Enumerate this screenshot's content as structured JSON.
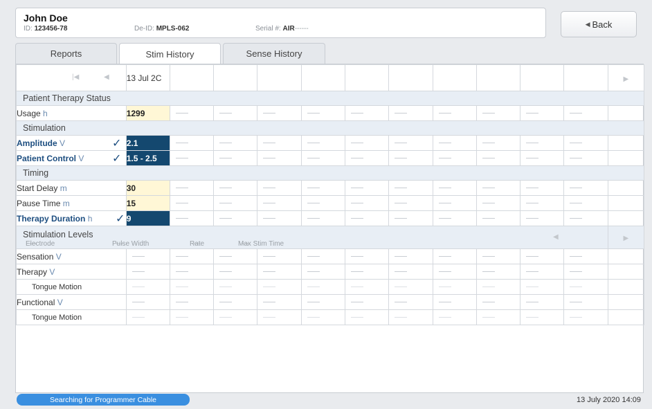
{
  "patient": {
    "name": "John Doe",
    "id_label": "ID:",
    "id_value": "123456-78",
    "deid_label": "De-ID:",
    "deid_value": "MPLS-062",
    "serial_label": "Serial #:",
    "serial_value": "AIR",
    "serial_suffix": "------"
  },
  "back_button": {
    "label": "Back"
  },
  "tabs": [
    {
      "label": "Reports",
      "active": false
    },
    {
      "label": "Stim History",
      "active": true
    },
    {
      "label": "Sense History",
      "active": false
    }
  ],
  "grid": {
    "date_column": "13 Jul 2C",
    "sections": {
      "patient_therapy_status": "Patient Therapy Status",
      "stimulation": "Stimulation",
      "timing": "Timing"
    },
    "rows": {
      "usage": {
        "label": "Usage",
        "unit": "h",
        "value": "1299"
      },
      "amplitude": {
        "label": "Amplitude",
        "unit": "V",
        "value": "2.1"
      },
      "patient_control": {
        "label": "Patient Control",
        "unit": "V",
        "value": "1.5 - 2.5"
      },
      "start_delay": {
        "label": "Start Delay",
        "unit": "m",
        "value": "30"
      },
      "pause_time": {
        "label": "Pause Time",
        "unit": "m",
        "value": "15"
      },
      "therapy_duration": {
        "label": "Therapy Duration",
        "unit": "h",
        "value": "9"
      }
    },
    "levels": {
      "title": "Stimulation Levels",
      "electrode": "Electrode",
      "pulse_width": "Pulse Width",
      "rate": "Rate",
      "max_stim_time": "Max Stim Time",
      "dash": "---",
      "rows": [
        {
          "label": "Sensation",
          "unit": "V"
        },
        {
          "label": "Therapy",
          "unit": "V"
        },
        {
          "label": "Tongue Motion",
          "unit": ""
        },
        {
          "label": "Functional",
          "unit": "V"
        },
        {
          "label": "Tongue Motion",
          "unit": ""
        }
      ]
    },
    "check_glyph": "✓"
  },
  "status": {
    "message": "Searching for Programmer Cable",
    "datetime": "13 July 2020 14:09"
  },
  "colors": {
    "accent_dark": "#14486f",
    "highlight_yellow": "#fff7d6",
    "status_blue": "#3a8fe0"
  }
}
